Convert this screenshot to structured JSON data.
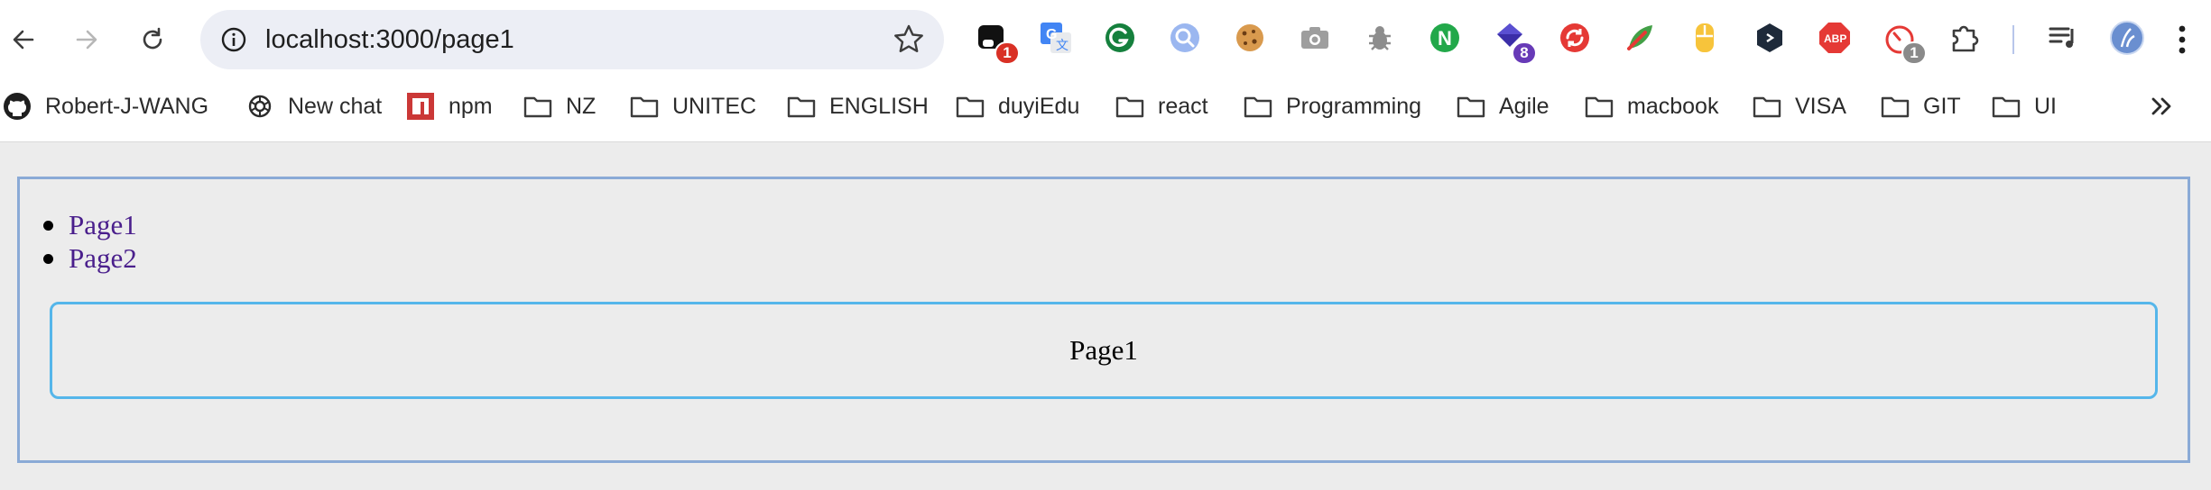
{
  "browser": {
    "url": "localhost:3000/page1",
    "nav": {
      "back": "back-arrow-icon",
      "forward": "forward-arrow-icon",
      "reload": "reload-icon"
    },
    "extensions": [
      {
        "name": "ext-1",
        "badge": "1",
        "badge_color": "#d93025"
      },
      {
        "name": "translate-ext",
        "badge": ""
      },
      {
        "name": "grammarly-ext",
        "badge": ""
      },
      {
        "name": "search-ext",
        "badge": ""
      },
      {
        "name": "cookie-ext",
        "badge": ""
      },
      {
        "name": "camera-ext",
        "badge": ""
      },
      {
        "name": "bug-ext",
        "badge": ""
      },
      {
        "name": "n-ext",
        "badge": ""
      },
      {
        "name": "gem-ext",
        "badge": "8",
        "badge_color": "#673ab7"
      },
      {
        "name": "sync-ext",
        "badge": ""
      },
      {
        "name": "leaf-ext",
        "badge": ""
      },
      {
        "name": "mouse-ext",
        "badge": ""
      },
      {
        "name": "dark-ext",
        "badge": ""
      },
      {
        "name": "adblock-ext",
        "badge": "",
        "label": "ABP"
      },
      {
        "name": "speed-ext",
        "badge": "1",
        "badge_color": "#8a8a8a"
      },
      {
        "name": "puzzle-ext",
        "badge": ""
      },
      {
        "name": "media-ext",
        "badge": ""
      },
      {
        "name": "profile-avatar",
        "badge": ""
      }
    ]
  },
  "bookmarks": [
    {
      "label": "Robert-J-WANG",
      "icon": "github-icon"
    },
    {
      "label": "New chat",
      "icon": "openai-icon"
    },
    {
      "label": "npm",
      "icon": "npm-icon"
    },
    {
      "label": "NZ",
      "icon": "folder-icon"
    },
    {
      "label": "UNITEC",
      "icon": "folder-icon"
    },
    {
      "label": "ENGLISH",
      "icon": "folder-icon"
    },
    {
      "label": "duyiEdu",
      "icon": "folder-icon"
    },
    {
      "label": "react",
      "icon": "folder-icon"
    },
    {
      "label": "Programming",
      "icon": "folder-icon"
    },
    {
      "label": "Agile",
      "icon": "folder-icon"
    },
    {
      "label": "macbook",
      "icon": "folder-icon"
    },
    {
      "label": "VISA",
      "icon": "folder-icon"
    },
    {
      "label": "GIT",
      "icon": "folder-icon"
    },
    {
      "label": "UI",
      "icon": "folder-icon"
    }
  ],
  "page": {
    "links": [
      "Page1",
      "Page2"
    ],
    "content": "Page1"
  },
  "colors": {
    "link": "#4a1f8c",
    "outer_border": "#8aaad6",
    "inner_border": "#55b6ea",
    "background": "#ececec"
  }
}
